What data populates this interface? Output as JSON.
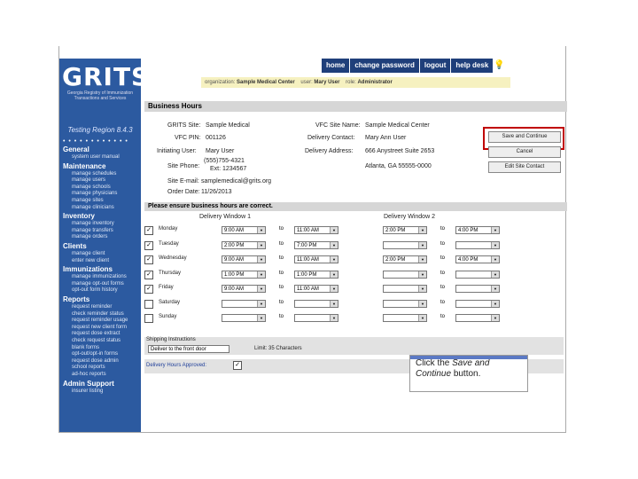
{
  "topnav": {
    "home": "home",
    "change_password": "change password",
    "logout": "logout",
    "help_desk": "help desk",
    "bulb": "💡"
  },
  "userbar": {
    "org_label": "organization:",
    "org": "Sample Medical Center",
    "user_label": "user:",
    "user": "Mary User",
    "role_label": "role:",
    "role": "Administrator"
  },
  "logo": {
    "name": "GRITS",
    "subtitle1": "Georgia Registry of Immunization",
    "subtitle2": "Transactions and Services"
  },
  "sidebar": {
    "region": "Testing Region 8.4.3",
    "dots": "• • • • • • • • • • • •",
    "sections": [
      {
        "title": "General",
        "items": [
          "system user manual"
        ]
      },
      {
        "title": "Maintenance",
        "items": [
          "manage schedules",
          "manage users",
          "manage schools",
          "manage physicians",
          "manage sites",
          "manage clinicians"
        ]
      },
      {
        "title": "Inventory",
        "items": [
          "manage inventory",
          "manage transfers",
          "manage orders"
        ]
      },
      {
        "title": "Clients",
        "items": [
          "manage client",
          "enter new client"
        ]
      },
      {
        "title": "Immunizations",
        "items": [
          "manage immunizations",
          "manage opt-out forms",
          "opt-out form history"
        ]
      },
      {
        "title": "Reports",
        "items": [
          "request reminder",
          "check reminder status",
          "request reminder usage",
          "request new client form",
          "request dose extract",
          "check request status",
          "blank forms",
          "opt-out/opt-in forms",
          "request dose admin",
          "school reports",
          "ad-hoc reports"
        ]
      },
      {
        "title": "Admin Support",
        "items": [
          "insurer listing"
        ]
      }
    ]
  },
  "business_hours": {
    "title": "Business Hours",
    "grits_site_label": "GRITS Site:",
    "grits_site": "Sample Medical",
    "vfc_pin_label": "VFC PIN:",
    "vfc_pin": "001126",
    "initiating_user_label": "Initiating User:",
    "initiating_user": "Mary User",
    "site_phone_label": "Site Phone:",
    "site_phone": "(555)755-4321",
    "site_phone_ext": "Ext: 1234567",
    "site_email_label": "Site E-mail:",
    "site_email": "samplemedical@grits.org",
    "order_date_label": "Order Date:",
    "order_date": "11/26/2013",
    "vfc_site_name_label": "VFC Site Name:",
    "vfc_site_name": "Sample Medical Center",
    "delivery_contact_label": "Delivery Contact:",
    "delivery_contact": "Mary Ann User",
    "delivery_address_label": "Delivery Address:",
    "delivery_address": "666 Anystreet Suite 2653",
    "delivery_city": "Atlanta, GA 55555-0000"
  },
  "buttons": {
    "save_continue": "Save and Continue",
    "cancel": "Cancel",
    "edit_site_contact": "Edit Site Contact"
  },
  "schedule": {
    "banner": "Please ensure business hours are correct.",
    "window1": "Delivery Window 1",
    "window2": "Delivery Window 2",
    "to": "to",
    "days": [
      {
        "name": "Monday",
        "checked": true,
        "w1s": "9:00 AM",
        "w1e": "11:00 AM",
        "w2s": "2:00 PM",
        "w2e": "4:00 PM"
      },
      {
        "name": "Tuesday",
        "checked": true,
        "w1s": "2:00 PM",
        "w1e": "7:00 PM",
        "w2s": "",
        "w2e": ""
      },
      {
        "name": "Wednesday",
        "checked": true,
        "w1s": "9:00 AM",
        "w1e": "11:00 AM",
        "w2s": "2:00 PM",
        "w2e": "4:00 PM"
      },
      {
        "name": "Thursday",
        "checked": true,
        "w1s": "1:00 PM",
        "w1e": "1:00 PM",
        "w2s": "",
        "w2e": ""
      },
      {
        "name": "Friday",
        "checked": true,
        "w1s": "9:00 AM",
        "w1e": "11:00 AM",
        "w2s": "",
        "w2e": ""
      },
      {
        "name": "Saturday",
        "checked": false,
        "w1s": "",
        "w1e": "",
        "w2s": "",
        "w2e": ""
      },
      {
        "name": "Sunday",
        "checked": false,
        "w1s": "",
        "w1e": "",
        "w2s": "",
        "w2e": ""
      }
    ]
  },
  "shipping": {
    "label": "Shipping Instructions",
    "value": "Deliver to the front door",
    "limit": "Limit: 35 Characters"
  },
  "delivery_hours": {
    "label": "Delivery Hours Approved:",
    "checked": true
  },
  "callout": {
    "line1": "Click the",
    "em1": "Save and",
    "em2": "Continue",
    "line2": "button."
  }
}
